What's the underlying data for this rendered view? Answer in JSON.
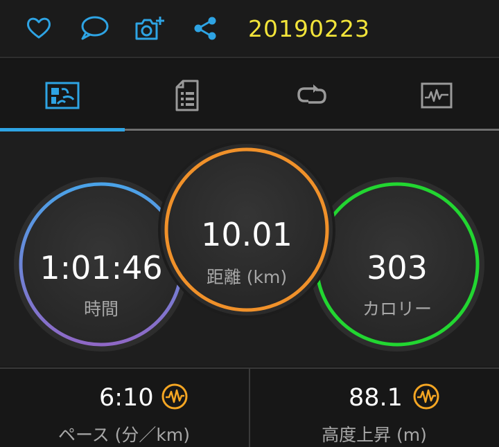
{
  "header": {
    "title": "20190223",
    "actions": [
      "like-icon",
      "comment-icon",
      "add-photo-icon",
      "share-icon"
    ],
    "accent": "#2ea4e4",
    "title_color": "#f2e43a"
  },
  "tabs": {
    "items": [
      "stats-icon",
      "details-icon",
      "laps-icon",
      "chart-icon"
    ],
    "active_index": 0
  },
  "stats": {
    "time": {
      "value": "1:01:46",
      "label": "時間",
      "colors": [
        "#4aa3e8",
        "#8f68c6"
      ]
    },
    "distance": {
      "value": "10.01",
      "label": "距離 (km)",
      "color": "#f0912a"
    },
    "calories": {
      "value": "303",
      "label": "カロリー",
      "color": "#22d631"
    }
  },
  "metrics": {
    "pace": {
      "value": "6:10",
      "label": "ペース (分／km)",
      "icon": "activity-badge-icon"
    },
    "elevation": {
      "value": "88.1",
      "label": "高度上昇 (m)",
      "icon": "activity-badge-icon"
    },
    "badge_color": "#f5a623"
  }
}
